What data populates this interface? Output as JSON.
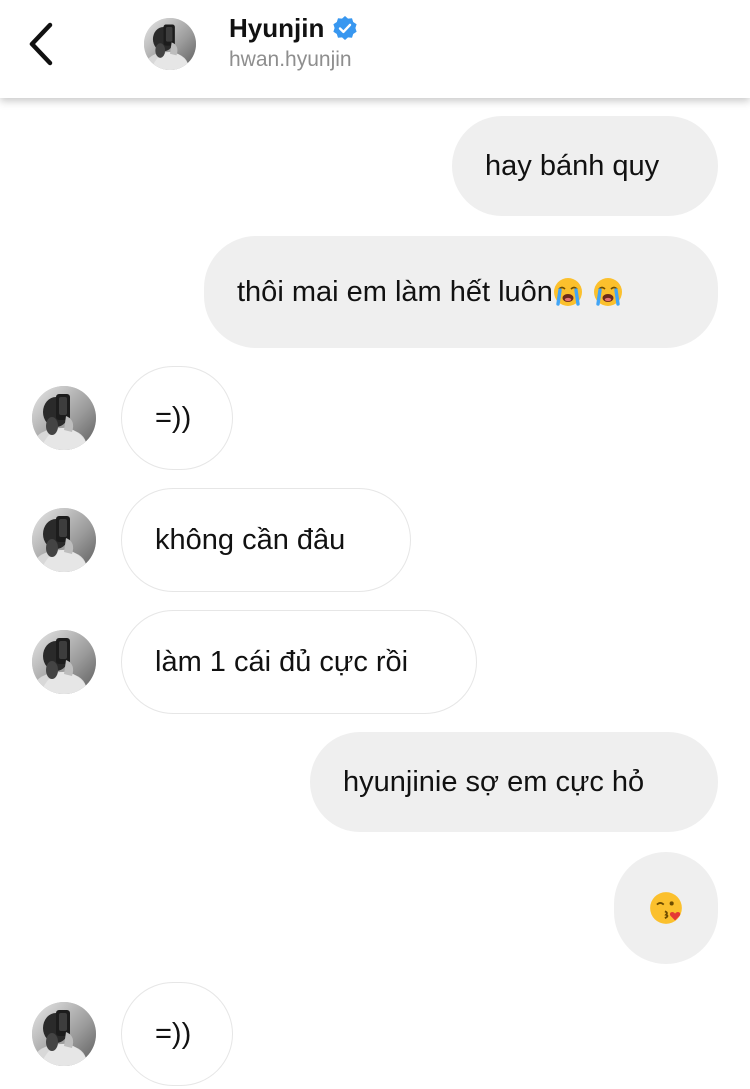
{
  "header": {
    "back_icon": "chevron-left-icon",
    "name": "Hyunjin",
    "verified_icon": "verified-badge-icon",
    "username": "hwan.hyunjin"
  },
  "colors": {
    "outgoing_bubble": "#efefef",
    "incoming_border": "#e6e6e6",
    "verified_blue": "#3897f0",
    "subtitle_gray": "#8e8e8e"
  },
  "messages": [
    {
      "direction": "out",
      "text": "hay bánh quy"
    },
    {
      "direction": "out",
      "text": "thôi mai em làm hết luôn",
      "emojis": [
        "loudly-crying-face-emoji",
        "loudly-crying-face-emoji"
      ]
    },
    {
      "direction": "in",
      "text": "=))"
    },
    {
      "direction": "in",
      "text": "không cần đâu"
    },
    {
      "direction": "in",
      "text": "làm 1 cái đủ cực rồi"
    },
    {
      "direction": "out",
      "text": "hyunjinie sợ em cực hỏ"
    },
    {
      "direction": "out",
      "emojis": [
        "face-blowing-a-kiss-emoji"
      ]
    },
    {
      "direction": "in",
      "text": "=))"
    }
  ]
}
